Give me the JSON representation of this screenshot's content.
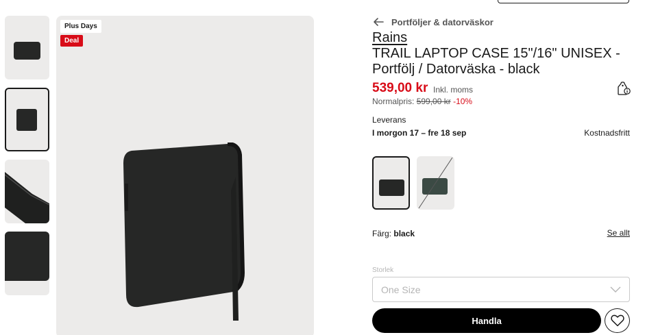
{
  "badges": {
    "plus_days": "Plus Days",
    "deal": "Deal"
  },
  "breadcrumb": {
    "label": "Portföljer & datorväskor"
  },
  "product": {
    "brand": "Rains",
    "title": "TRAIL LAPTOP CASE 15\"/16\" UNISEX - Portfölj / Datorväska - black",
    "price": "539,00 kr",
    "incl_vat": "Inkl. moms",
    "normal_label": "Normalpris:",
    "normal_price": "599,00 kr",
    "discount": "-10%"
  },
  "delivery": {
    "label": "Leverans",
    "dates": "I morgon 17 – fre 18 sep",
    "cost": "Kostnadsfritt"
  },
  "color": {
    "label": "Färg:",
    "value": "black",
    "see_all": "Se allt"
  },
  "size": {
    "label": "Storlek",
    "value": "One Size"
  },
  "actions": {
    "buy": "Handla"
  },
  "icons": {
    "back": "arrow-left-icon",
    "price_tag": "price-tag-info-icon",
    "chevron": "chevron-down-icon",
    "wishlist": "heart-icon"
  },
  "colors": {
    "deal_red": "#d80c18",
    "image_bg": "#ecebea",
    "text": "#1a1a1a",
    "product": "#262726"
  }
}
